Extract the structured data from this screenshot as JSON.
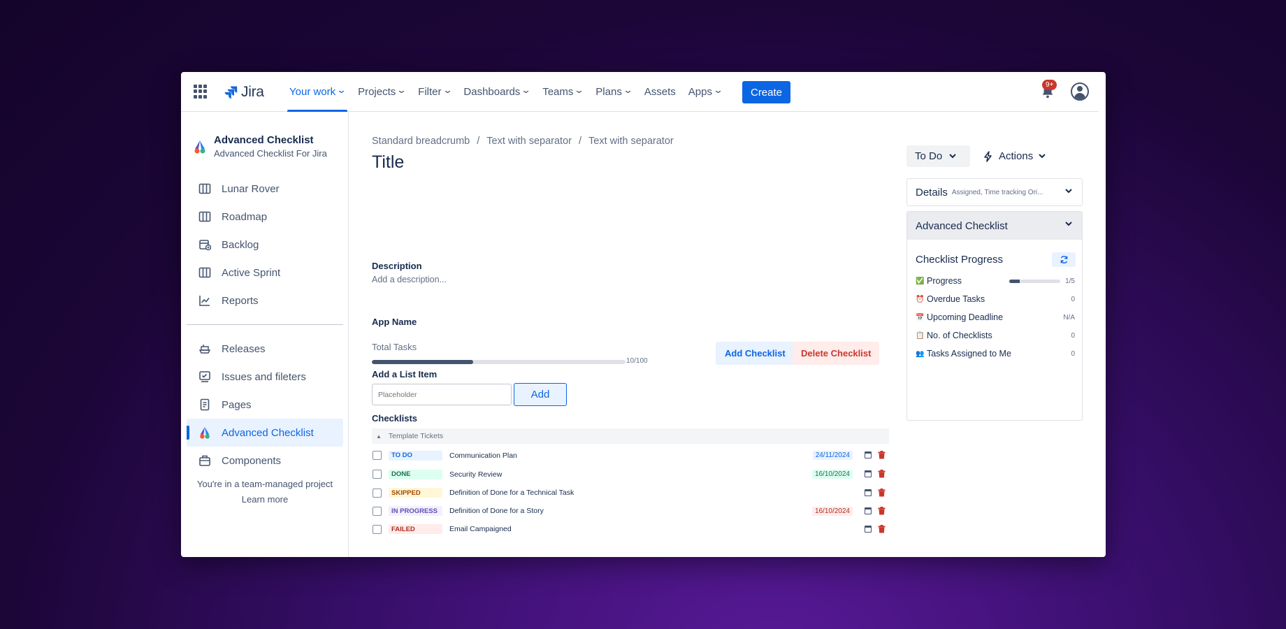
{
  "nav": {
    "logo": "Jira",
    "items": [
      {
        "label": "Your work",
        "dropdown": true,
        "active": true
      },
      {
        "label": "Projects",
        "dropdown": true
      },
      {
        "label": "Filter",
        "dropdown": true
      },
      {
        "label": "Dashboards",
        "dropdown": true
      },
      {
        "label": "Teams",
        "dropdown": true
      },
      {
        "label": "Plans",
        "dropdown": true
      },
      {
        "label": "Assets",
        "dropdown": false
      },
      {
        "label": "Apps",
        "dropdown": true
      }
    ],
    "create_label": "Create",
    "notification_badge": "9+"
  },
  "sidebar": {
    "project_title": "Advanced Checklist",
    "project_subtitle": "Advanced Checklist For Jira",
    "items": [
      {
        "label": "Lunar Rover",
        "icon": "board-icon"
      },
      {
        "label": "Roadmap",
        "icon": "board-icon"
      },
      {
        "label": "Backlog",
        "icon": "backlog-icon"
      },
      {
        "label": "Active Sprint",
        "icon": "board-icon"
      },
      {
        "label": "Reports",
        "icon": "chart-icon"
      }
    ],
    "items2": [
      {
        "label": "Releases",
        "icon": "ship-icon"
      },
      {
        "label": "Issues and fileters",
        "icon": "issues-icon"
      },
      {
        "label": "Pages",
        "icon": "page-icon"
      },
      {
        "label": "Advanced Checklist",
        "icon": "app-logo-icon",
        "active": true
      },
      {
        "label": "Components",
        "icon": "component-icon"
      }
    ],
    "footer_text": "You're in a team-managed project",
    "footer_link": "Learn more"
  },
  "main": {
    "breadcrumbs": [
      "Standard breadcrumb",
      "Text with separator",
      "Text with separator"
    ],
    "breadcrumb_separator": "/",
    "title": "Title",
    "description_label": "Description",
    "description_placeholder": "Add a description...",
    "app_name_label": "App Name",
    "total_tasks_label": "Total Tasks",
    "progress_count": "10/100",
    "progress_fraction": 0.4,
    "add_checklist_label": "Add Checklist",
    "delete_checklist_label": "Delete Checklist",
    "add_item_label": "Add a List Item",
    "input_placeholder": "Placeholder",
    "add_button_label": "Add",
    "checklists_label": "Checklists",
    "group_name": "Template Tickets",
    "rows": [
      {
        "status": "TO DO",
        "status_color": "#0c66e4",
        "status_bg": "#e9f2ff",
        "text": "Communication Plan",
        "due": "24/11/2024",
        "due_color": "#0c66e4",
        "due_bg": "#e9f2ff"
      },
      {
        "status": "DONE",
        "status_color": "#216e4e",
        "status_bg": "#dcfff1",
        "text": "Security Review",
        "due": "16/10/2024",
        "due_color": "#216e4e",
        "due_bg": "#dcfff1"
      },
      {
        "status": "SKIPPED",
        "status_color": "#a54800",
        "status_bg": "#fff7d6",
        "text": "Definition of Done for a Technical Task",
        "due": "",
        "due_color": "",
        "due_bg": ""
      },
      {
        "status": "IN PROGRESS",
        "status_color": "#5e4db2",
        "status_bg": "#f3f0ff",
        "text": "Definition of Done for a Story",
        "due": "16/10/2024",
        "due_color": "#ae2e24",
        "due_bg": "#ffeceb"
      },
      {
        "status": "FAILED",
        "status_color": "#ae2e24",
        "status_bg": "#ffeceb",
        "text": "Email Campaigned",
        "due": "",
        "due_color": "",
        "due_bg": ""
      }
    ]
  },
  "right": {
    "status_label": "To Do",
    "actions_label": "Actions",
    "details_title": "Details",
    "details_subtitle": "Assigned, Time tracking Ori...",
    "adv_title": "Advanced Checklist",
    "progress_title": "Checklist Progress",
    "stats": [
      {
        "icon": "✅",
        "label": "Progress",
        "value": "1/5",
        "bar": 0.2
      },
      {
        "icon": "⏰",
        "label": "Overdue Tasks",
        "value": "0"
      },
      {
        "icon": "📅",
        "label": "Upcoming Deadline",
        "value": "N/A"
      },
      {
        "icon": "📋",
        "label": "No. of Checklists",
        "value": "0"
      },
      {
        "icon": "👥",
        "label": "Tasks Assigned to Me",
        "value": "0"
      }
    ]
  }
}
